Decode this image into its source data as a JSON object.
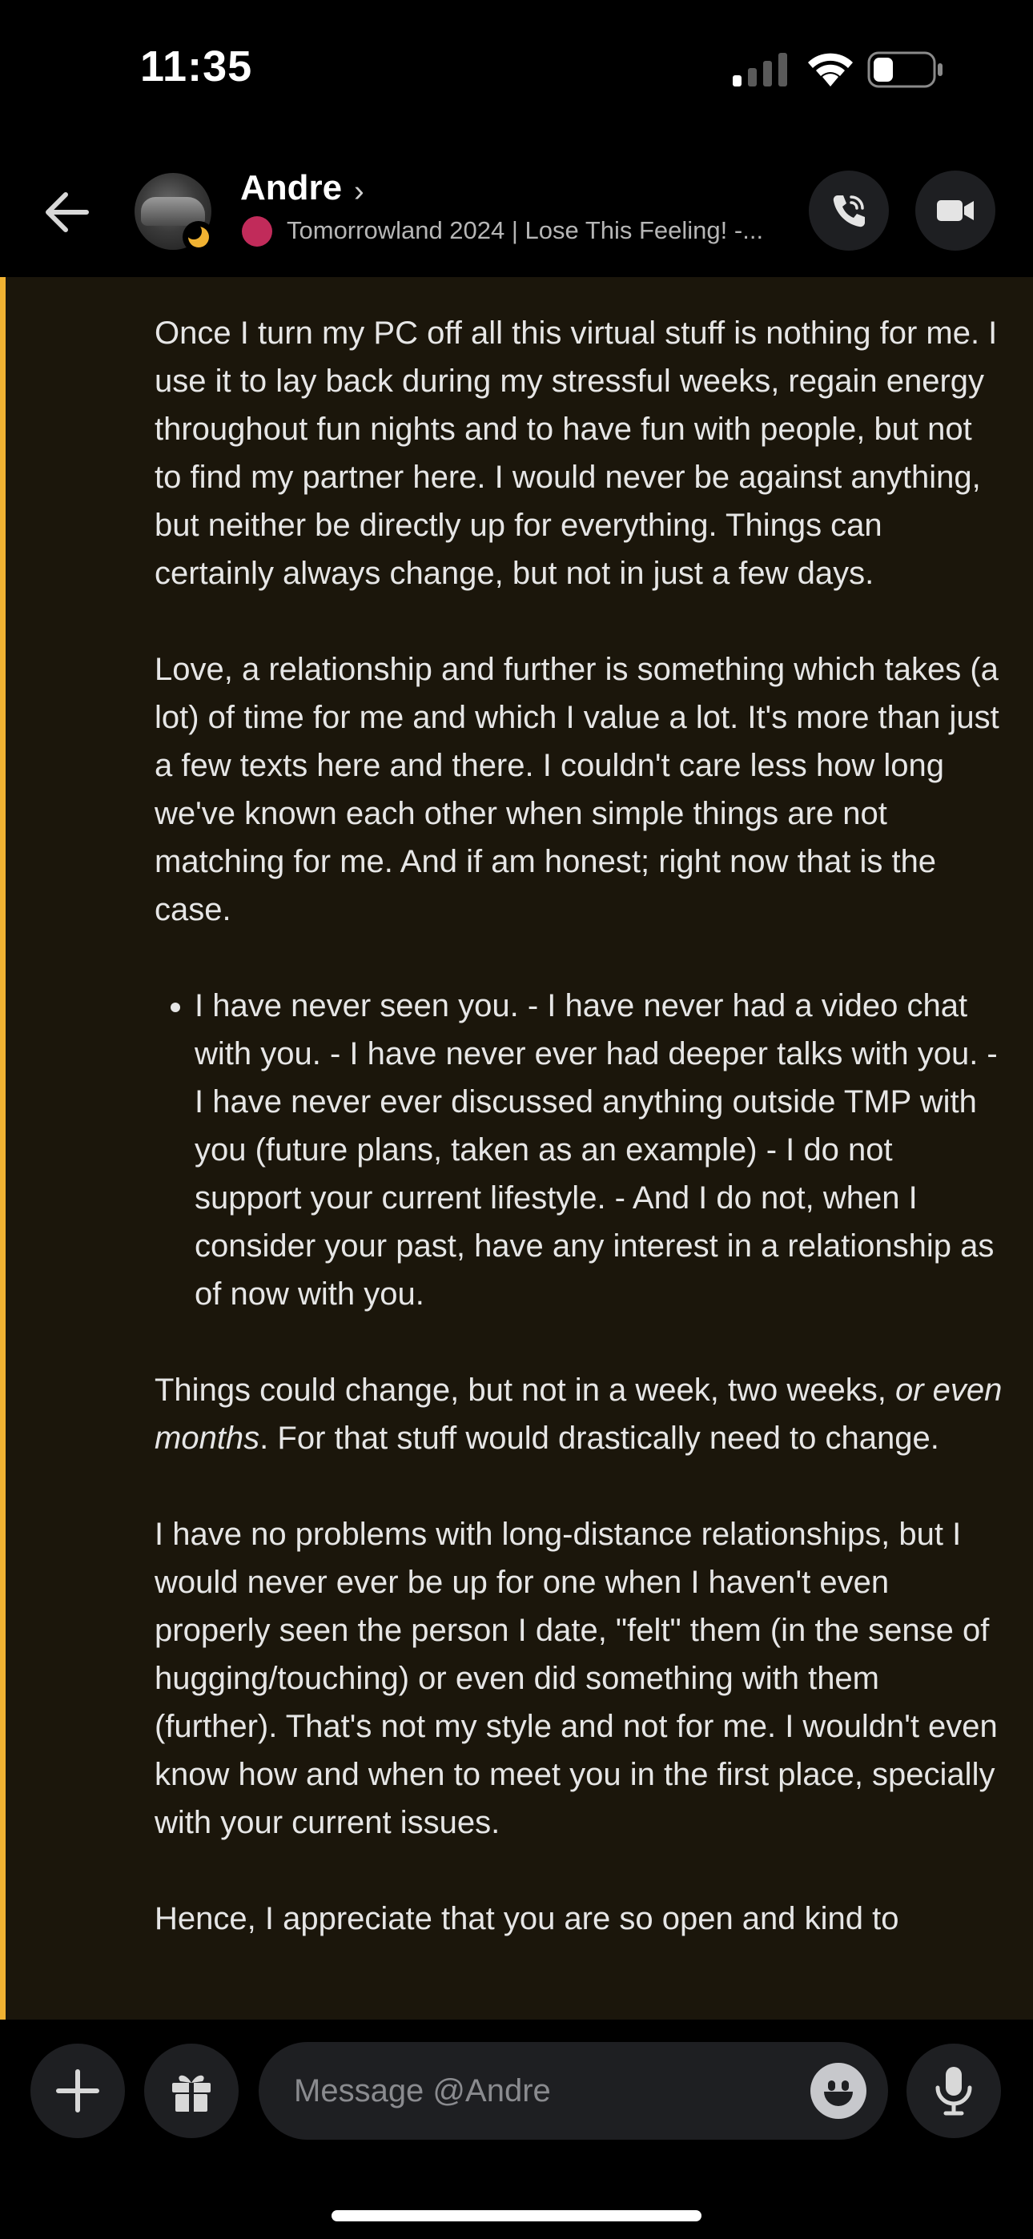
{
  "status_bar": {
    "time": "11:35",
    "icons": [
      "cellular-signal-icon",
      "wifi-icon",
      "battery-icon"
    ]
  },
  "header": {
    "contact_name": "Andre",
    "name_chevron": "›",
    "activity": "Tomorrowland 2024 | Lose This Feeling! -...",
    "presence": "idle",
    "buttons": [
      "back-arrow-icon",
      "phone-call-icon",
      "video-camera-icon"
    ]
  },
  "message": {
    "p1": "Once I turn my PC off all this virtual stuff is nothing for me. I use it to lay back during my stressful weeks, regain energy throughout fun nights and to have fun with people, but not to find my partner here. I would never be against anything, but neither be directly up for everything. Things can certainly always change, but not in just a few days.",
    "p2": "Love, a relationship and further is something which takes (a lot) of time for me and which I value a lot. It's more than just a few texts here and there. I couldn't care less how long we've known each other when simple things are not matching for me. And if am honest; right now that is the case.",
    "bullet": "I have never seen you. - I have never had a video chat with you. - I have never ever had deeper talks with you. - I have never ever discussed anything outside TMP with you (future plans, taken as an example) - I do not support your current lifestyle. - And I do not, when I consider your past, have any interest in a relationship as of now with you.",
    "p3_start": "Things could change, but not in a week, two weeks, ",
    "p3_italic": "or even months",
    "p3_end": ". For that stuff would drastically need to change.",
    "p4": "I have no problems with long-distance relationships, but I would never ever be up for one when I haven't even properly seen the person I date, \"felt\" them (in the sense of hugging/touching) or even did something with them (further). That's not my style and not for me. I wouldn't even know how and when to meet you in the first place, specially with your current issues.",
    "p5_partial": "Hence, I appreciate that you are so open and kind to"
  },
  "composer": {
    "placeholder": "Message @Andre",
    "accent": "#f0b232"
  }
}
